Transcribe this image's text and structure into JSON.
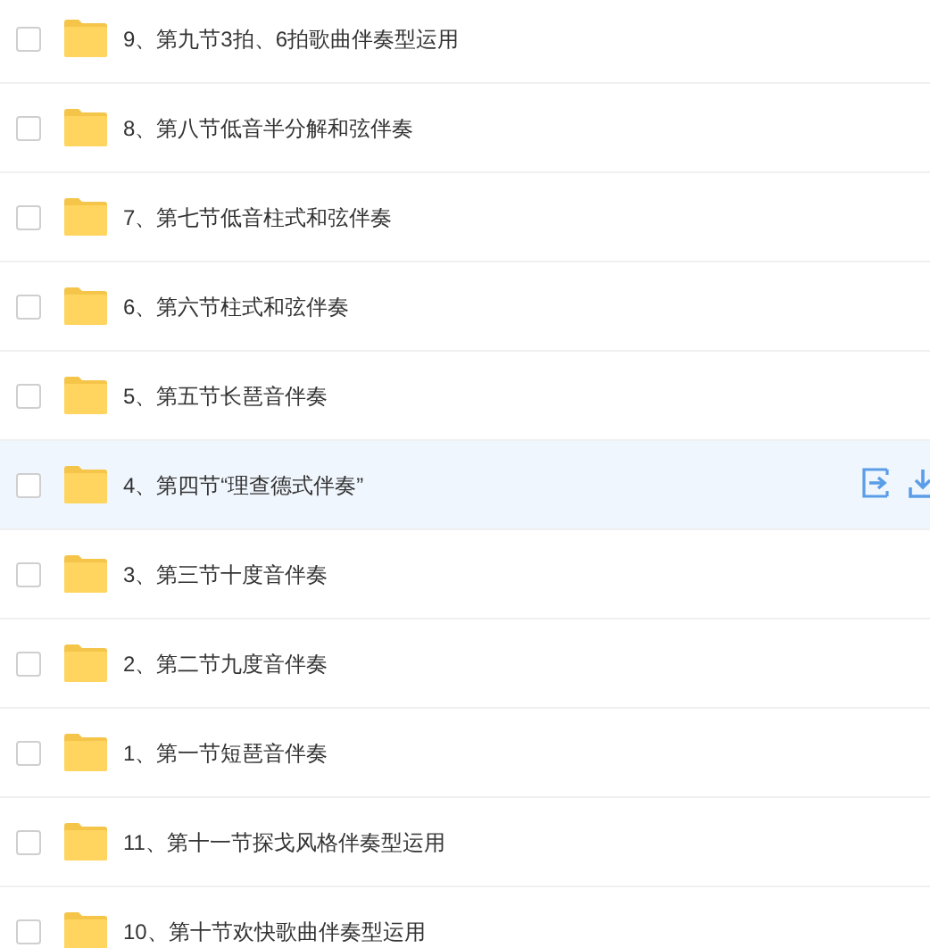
{
  "files": [
    {
      "name": "9、第九节3拍、6拍歌曲伴奏型运用",
      "checked": false,
      "highlighted": false
    },
    {
      "name": "8、第八节低音半分解和弦伴奏",
      "checked": false,
      "highlighted": false
    },
    {
      "name": "7、第七节低音柱式和弦伴奏",
      "checked": false,
      "highlighted": false
    },
    {
      "name": "6、第六节柱式和弦伴奏",
      "checked": false,
      "highlighted": false
    },
    {
      "name": "5、第五节长琶音伴奏",
      "checked": false,
      "highlighted": false
    },
    {
      "name": "4、第四节“理查德式伴奏”",
      "checked": false,
      "highlighted": true
    },
    {
      "name": "3、第三节十度音伴奏",
      "checked": false,
      "highlighted": false
    },
    {
      "name": "2、第二节九度音伴奏",
      "checked": false,
      "highlighted": false
    },
    {
      "name": "1、第一节短琶音伴奏",
      "checked": false,
      "highlighted": false
    },
    {
      "name": "11、第十一节探戈风格伴奏型运用",
      "checked": false,
      "highlighted": false
    },
    {
      "name": "10、第十节欢快歌曲伴奏型运用",
      "checked": false,
      "highlighted": false
    }
  ]
}
